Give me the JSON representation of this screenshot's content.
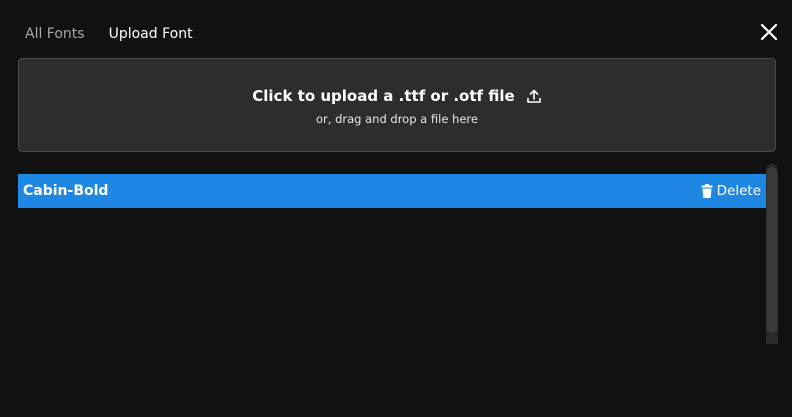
{
  "tabs": [
    {
      "label": "All Fonts",
      "active": false
    },
    {
      "label": "Upload Font",
      "active": true
    }
  ],
  "upload": {
    "title": "Click to upload a .ttf or .otf file",
    "subtitle": "or, drag and drop a file here",
    "icon": "upload-icon"
  },
  "fonts": [
    {
      "name": "Cabin-Bold",
      "delete_label": "Delete",
      "selected": true
    }
  ],
  "colors": {
    "background": "#111112",
    "dropzone": "#2d2d2f",
    "selected_row": "#1d87e3",
    "inactive_tab": "#a7a7a9"
  }
}
